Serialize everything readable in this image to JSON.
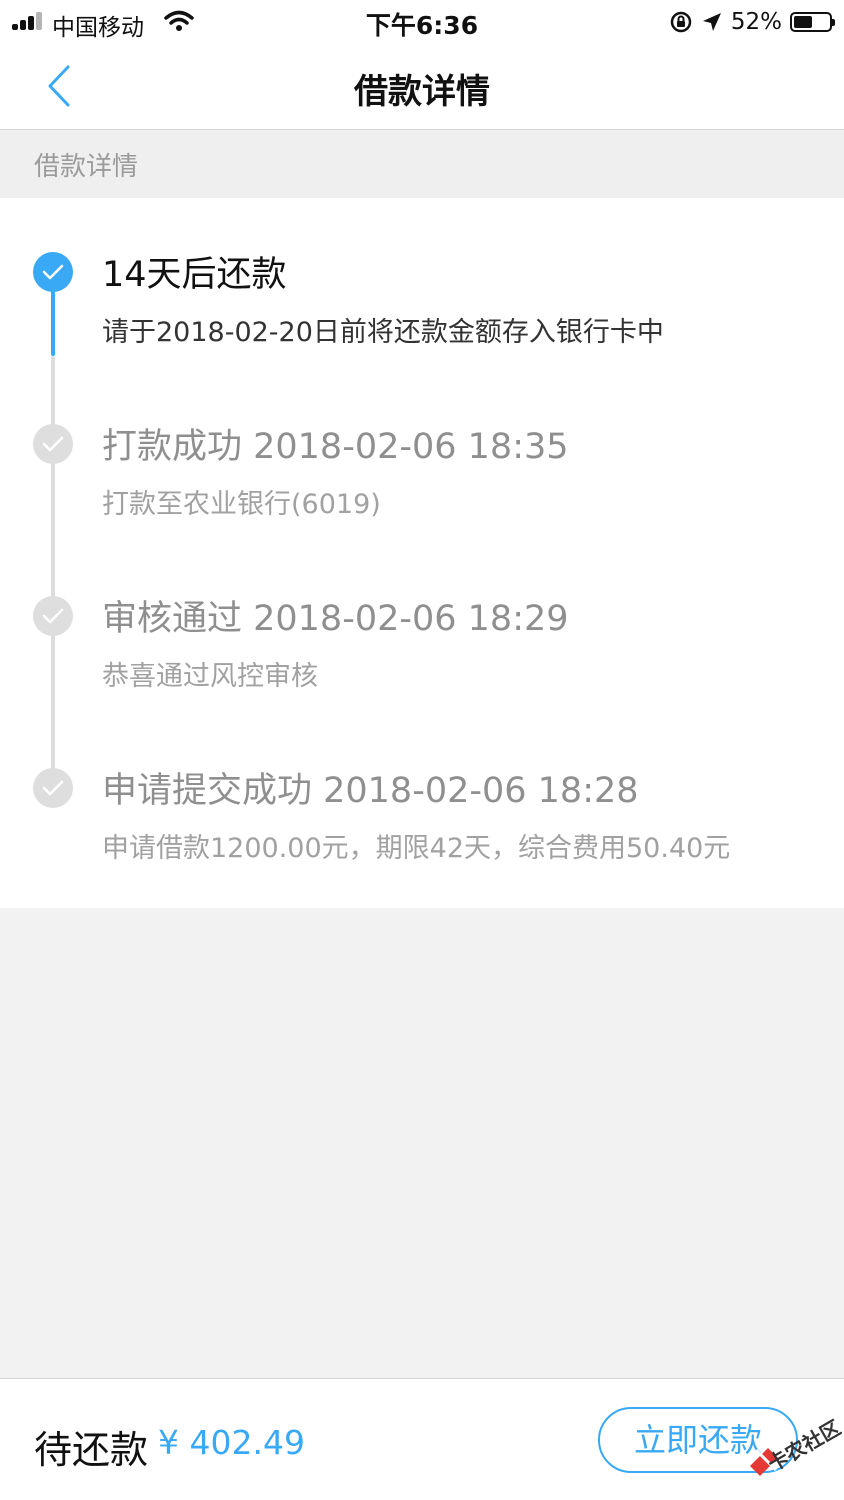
{
  "status_bar": {
    "carrier": "中国移动",
    "time": "下午6:36",
    "battery_percent": "52%",
    "battery_level": 0.52
  },
  "nav": {
    "title": "借款详情"
  },
  "section": {
    "header": "借款详情"
  },
  "timeline": [
    {
      "title": "14天后还款",
      "description": "请于2018-02-20日前将还款金额存入银行卡中",
      "active": true
    },
    {
      "title": "打款成功 2018-02-06 18:35",
      "description": "打款至农业银行(6019)",
      "active": false
    },
    {
      "title": "审核通过 2018-02-06 18:29",
      "description": "恭喜通过风控审核",
      "active": false
    },
    {
      "title": "申请提交成功 2018-02-06 18:28",
      "description": "申请借款1200.00元，期限42天，综合费用50.40元",
      "active": false
    }
  ],
  "bottom": {
    "pending_label": "待还款",
    "pending_amount": "¥ 402.49",
    "repay_button": "立即还款"
  },
  "watermark": {
    "text": "卡农社区"
  },
  "colors": {
    "accent": "#39a9f5",
    "inactive_dot": "#dedede",
    "background": "#f2f2f2"
  }
}
